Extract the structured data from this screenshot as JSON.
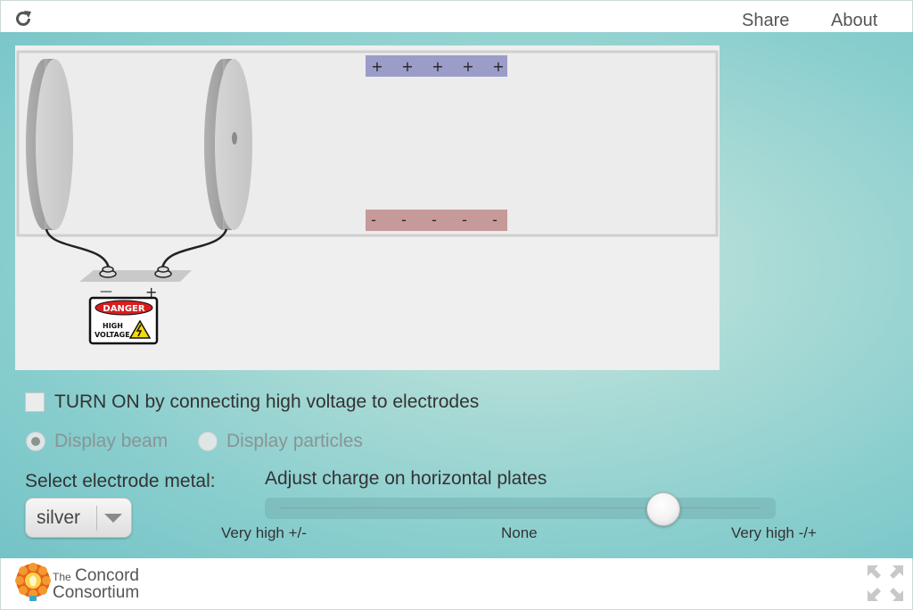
{
  "header": {
    "share_label": "Share",
    "about_label": "About",
    "reload_icon": "reload-icon"
  },
  "simulation": {
    "top_plate_symbols": [
      "+",
      "+",
      "+",
      "+",
      "+"
    ],
    "bottom_plate_symbols": [
      "-",
      "-",
      "-",
      "-",
      "-"
    ],
    "power_supply": {
      "negative_label": "—",
      "positive_label": "+",
      "danger_label": "DANGER",
      "warning_line1": "HIGH",
      "warning_line2": "VOLTAGE"
    },
    "colors": {
      "positive_plate": "#9c9cc9",
      "negative_plate": "#c79a9a",
      "electrode": "#cfcfcf"
    }
  },
  "controls": {
    "turn_on_label": "TURN ON by connecting high voltage to electrodes",
    "turn_on_checked": false,
    "display_beam_label": "Display beam",
    "display_particles_label": "Display particles",
    "display_mode": "beam",
    "electrode_metal_label": "Select electrode metal:",
    "electrode_metal_value": "silver",
    "charge_slider_label": "Adjust charge on horizontal plates",
    "charge_slider_value": 0.8,
    "tick_left": "Very high +/-",
    "tick_mid": "None",
    "tick_right": "Very high -/+"
  },
  "footer": {
    "brand_the": "The",
    "brand_concord": "Concord",
    "brand_consortium": "Consortium",
    "fullscreen_icon": "fullscreen-icon"
  }
}
